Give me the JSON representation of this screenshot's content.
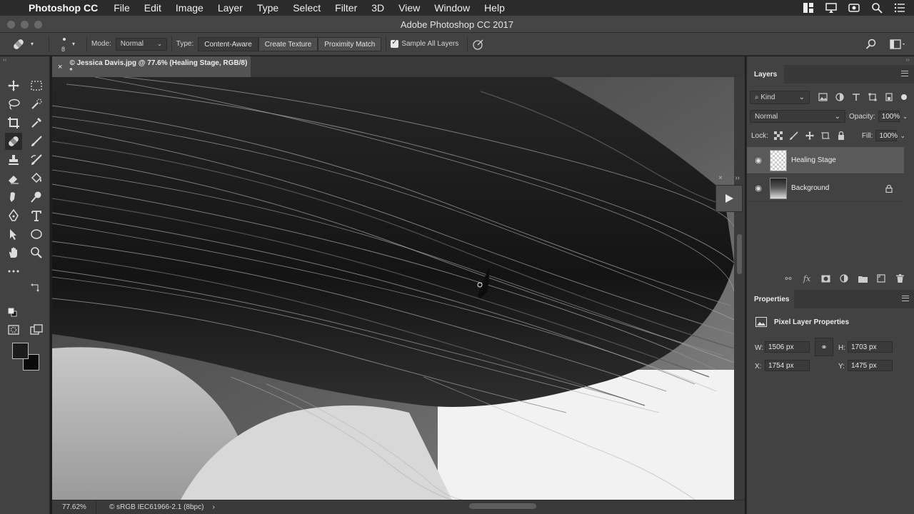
{
  "menubar": {
    "app_name": "Photoshop CC",
    "items": [
      "File",
      "Edit",
      "Image",
      "Layer",
      "Type",
      "Select",
      "Filter",
      "3D",
      "View",
      "Window",
      "Help"
    ],
    "tray_icons": [
      "control-strip-icon",
      "airplay-icon",
      "facetime-icon",
      "spotlight-icon",
      "notification-center-icon"
    ]
  },
  "window": {
    "title": "Adobe Photoshop CC 2017"
  },
  "options": {
    "brush_size": "8",
    "mode_label": "Mode:",
    "mode_value": "Normal",
    "type_label": "Type:",
    "type_buttons": [
      "Content-Aware",
      "Create Texture",
      "Proximity Match"
    ],
    "sample_all_layers": "Sample All Layers"
  },
  "document": {
    "tab_title": "© Jessica Davis.jpg @ 77.6% (Healing Stage, RGB/8) *",
    "zoom": "77.62%",
    "profile": "© sRGB IEC61966-2.1 (8bpc)"
  },
  "colors": {
    "foreground": "#1c1c1c",
    "background": "#0a0a0a",
    "ui_dark": "#424242"
  },
  "layers_panel": {
    "tab": "Layers",
    "filter_value": "Kind",
    "blend_mode": "Normal",
    "opacity_label": "Opacity:",
    "opacity_value": "100%",
    "lock_label": "Lock:",
    "fill_label": "Fill:",
    "fill_value": "100%",
    "layers": [
      {
        "name": "Healing Stage",
        "selected": true,
        "locked": false
      },
      {
        "name": "Background",
        "selected": false,
        "locked": true
      }
    ]
  },
  "properties_panel": {
    "tab": "Properties",
    "heading": "Pixel Layer Properties",
    "w_label": "W:",
    "w_value": "1506 px",
    "h_label": "H:",
    "h_value": "1703 px",
    "x_label": "X:",
    "x_value": "1754 px",
    "y_label": "Y:",
    "y_value": "1475 px"
  }
}
